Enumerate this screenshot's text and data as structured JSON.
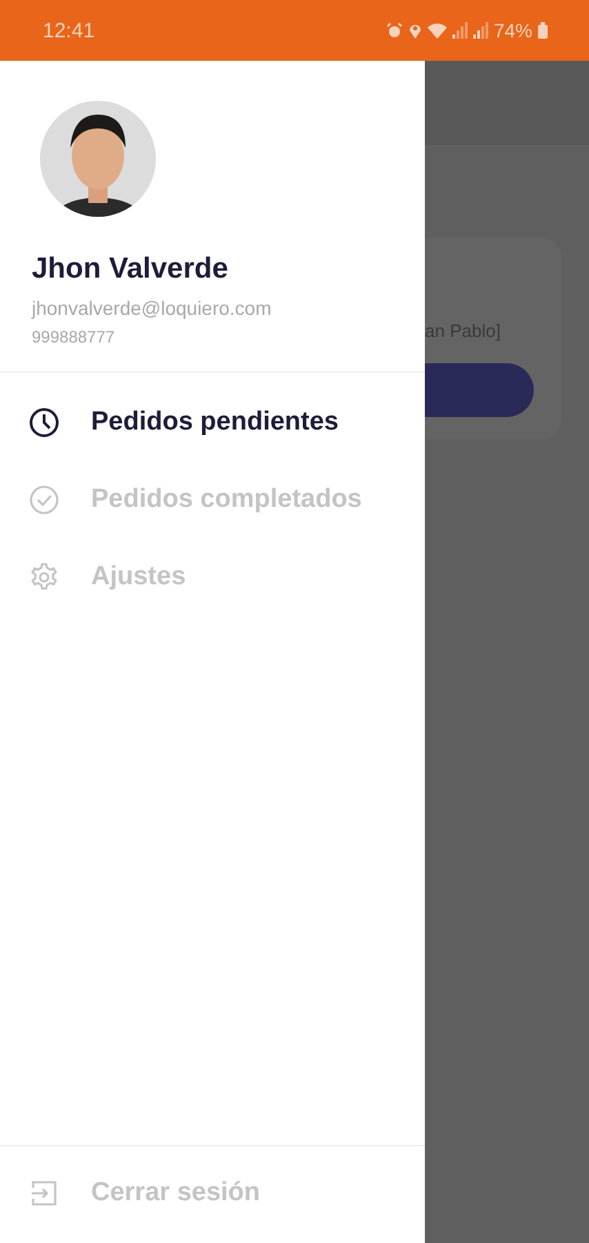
{
  "status_bar": {
    "time": "12:41",
    "battery": "74%"
  },
  "drawer": {
    "user": {
      "name": "Jhon Valverde",
      "email": "jhonvalverde@loquiero.com",
      "phone": "999888777"
    },
    "items": [
      {
        "label": "Pedidos pendientes",
        "selected": true
      },
      {
        "label": "Pedidos completados",
        "selected": false
      },
      {
        "label": "Ajustes",
        "selected": false
      }
    ],
    "logout": {
      "label": "Cerrar sesión"
    }
  },
  "background": {
    "card_text": "an Pablo]"
  }
}
